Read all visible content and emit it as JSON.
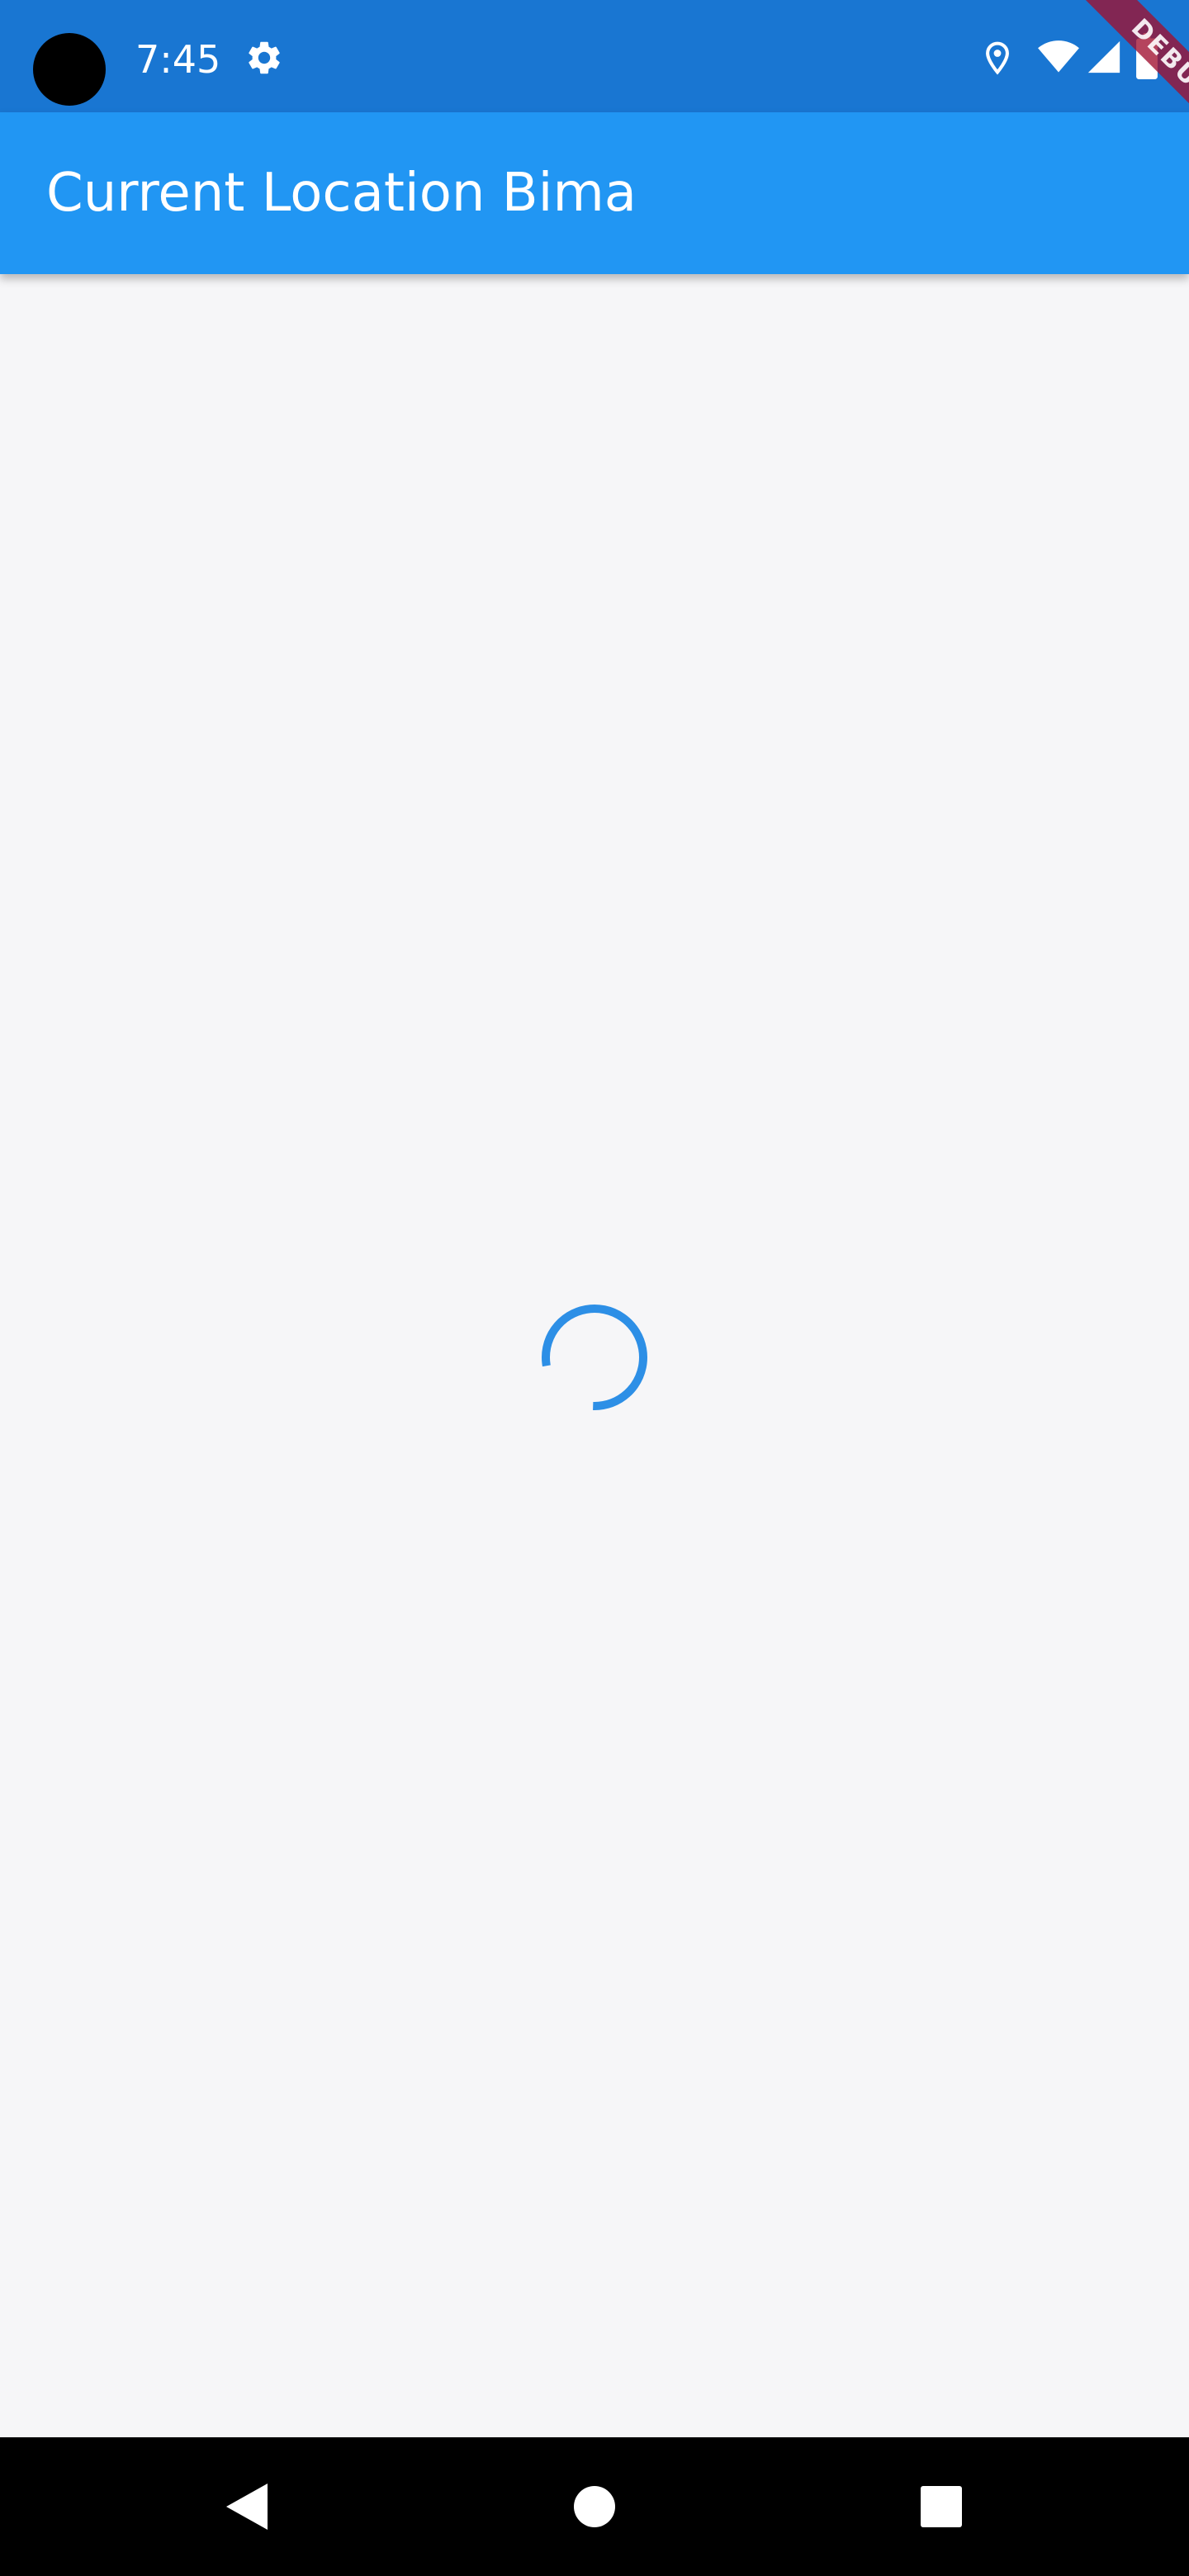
{
  "status_bar": {
    "time": "7:45",
    "icons": [
      "camera-cutout",
      "settings-gear-icon",
      "location-pin-icon",
      "wifi-icon",
      "signal-icon",
      "battery-icon"
    ]
  },
  "app_bar": {
    "title": "Current Location Bima",
    "color": "#2196f3"
  },
  "debug_banner": {
    "label": "DEBUG"
  },
  "content": {
    "state": "loading",
    "spinner_color": "#2d8fe6"
  },
  "nav_bar": {
    "buttons": [
      "back",
      "home",
      "recents"
    ]
  }
}
